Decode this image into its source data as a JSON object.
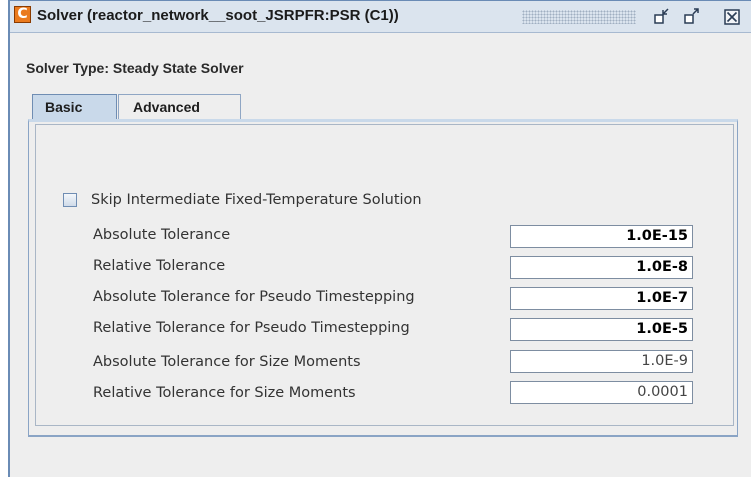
{
  "window": {
    "app_icon_letter": "C",
    "title": "Solver  (reactor_network__soot_JSRPFR:PSR (C1))"
  },
  "solver_type": {
    "label": "Solver Type: Steady State Solver"
  },
  "tabs": [
    {
      "label": "Basic",
      "selected": true
    },
    {
      "label": "Advanced",
      "selected": false
    }
  ],
  "basic": {
    "skip_checkbox": {
      "label": "Skip Intermediate Fixed-Temperature Solution",
      "checked": false
    },
    "rows": [
      {
        "label": "Absolute Tolerance",
        "value": "1.0E-15",
        "bold": true
      },
      {
        "label": "Relative Tolerance",
        "value": "1.0E-8",
        "bold": true
      },
      {
        "label": "Absolute Tolerance for Pseudo Timestepping",
        "value": "1.0E-7",
        "bold": true
      },
      {
        "label": "Relative Tolerance for Pseudo Timestepping",
        "value": "1.0E-5",
        "bold": true
      },
      {
        "label": "Absolute Tolerance for Size Moments",
        "value": "1.0E-9",
        "bold": false
      },
      {
        "label": "Relative Tolerance for Size Moments",
        "value": "0.0001",
        "bold": false
      }
    ]
  },
  "colors": {
    "titlebar": "#dbe4ee",
    "selected_tab": "#c9d9ea",
    "app_icon": "#ea7a1e"
  },
  "icons": {
    "minimize": "restore-down-icon",
    "maximize": "maximize-icon",
    "close": "close-icon"
  }
}
